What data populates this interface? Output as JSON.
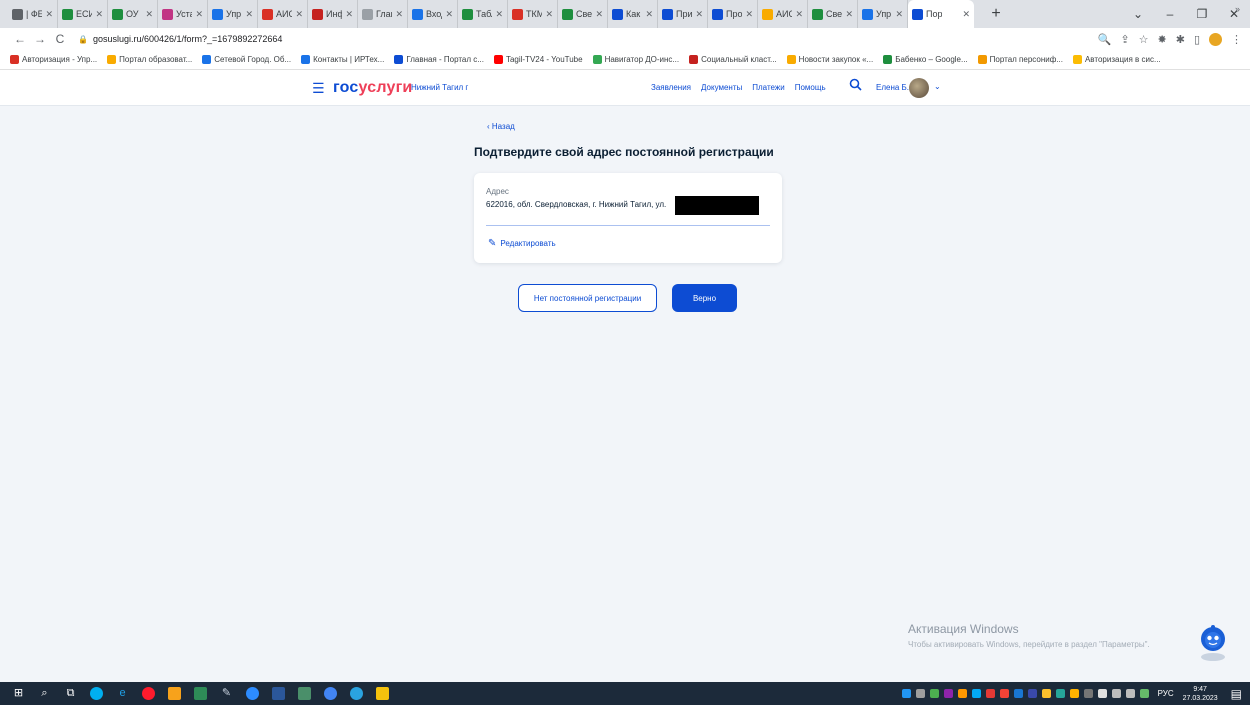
{
  "browser": {
    "tabs": [
      {
        "label": "| ФЕ",
        "color": "#5f6368"
      },
      {
        "label": "ЕСИ",
        "color": "#1e8e3e"
      },
      {
        "label": "ОУ",
        "color": "#1e8e3e"
      },
      {
        "label": "Уста",
        "color": "#c13584"
      },
      {
        "label": "Упр",
        "color": "#1a73e8"
      },
      {
        "label": "АИС",
        "color": "#d93025"
      },
      {
        "label": "Инф",
        "color": "#c5221f"
      },
      {
        "label": "Глав",
        "color": "#9aa0a6"
      },
      {
        "label": "Вход",
        "color": "#1a73e8"
      },
      {
        "label": "Табл",
        "color": "#1e8e3e"
      },
      {
        "label": "ТКМ",
        "color": "#d93025"
      },
      {
        "label": "Свед",
        "color": "#1e8e3e"
      },
      {
        "label": "Как",
        "color": "#0d4cd3"
      },
      {
        "label": "При",
        "color": "#0d4cd3"
      },
      {
        "label": "Про",
        "color": "#0d4cd3"
      },
      {
        "label": "АИС",
        "color": "#f9ab00"
      },
      {
        "label": "Свед",
        "color": "#1e8e3e"
      },
      {
        "label": "Упр",
        "color": "#1a73e8"
      }
    ],
    "active_tab": {
      "label": "Пор",
      "color": "#0d4cd3"
    },
    "new_tab": "+",
    "window_controls": {
      "dropdown": "⌄",
      "minimize": "–",
      "maximize": "❐",
      "close": "✕"
    },
    "nav": {
      "back": "←",
      "forward": "→",
      "reload": "C"
    },
    "url": "gosuslugi.ru/600426/1/form?_=1679892272664",
    "bookmarks": [
      {
        "label": "Авторизация - Упр...",
        "color": "#d93025"
      },
      {
        "label": "Портал образоват...",
        "color": "#f9ab00"
      },
      {
        "label": "Сетевой Город. Об...",
        "color": "#1a73e8"
      },
      {
        "label": "Контакты | ИРТех...",
        "color": "#1a73e8"
      },
      {
        "label": "Главная - Портал с...",
        "color": "#0d4cd3"
      },
      {
        "label": "Tagil-TV24 - YouTube",
        "color": "#ff0000"
      },
      {
        "label": "Навигатор ДО-инс...",
        "color": "#34a853"
      },
      {
        "label": "Социальный класт...",
        "color": "#c5221f"
      },
      {
        "label": "Новости закупок «...",
        "color": "#f9ab00"
      },
      {
        "label": "Бабенко – Google...",
        "color": "#1e8e3e"
      },
      {
        "label": "Портал персониф...",
        "color": "#f29900"
      },
      {
        "label": "Авторизация в сис...",
        "color": "#fbbc04"
      }
    ],
    "bookmarks_more": "»"
  },
  "site": {
    "logo_main": "гос",
    "logo_accent": "услуги",
    "city": "Нижний Тагил г",
    "nav": [
      "Заявления",
      "Документы",
      "Платежи",
      "Помощь"
    ],
    "user": "Елена Б.",
    "brand_color": "#0d4cd3"
  },
  "page": {
    "back": "‹ Назад",
    "title": "Подтвердите свой адрес постоянной регистрации",
    "address_label": "Адрес",
    "address_value": "622016, обл. Свердловская, г. Нижний Тагил, ул.",
    "edit": "Редактировать",
    "btn_no_registration": "Нет постоянной регистрации",
    "btn_correct": "Верно"
  },
  "watermark": {
    "title": "Активация Windows",
    "subtitle": "Чтобы активировать Windows, перейдите в раздел \"Параметры\"."
  },
  "taskbar": {
    "lang": "РУС",
    "time": "9:47",
    "date": "27.03.2023"
  }
}
